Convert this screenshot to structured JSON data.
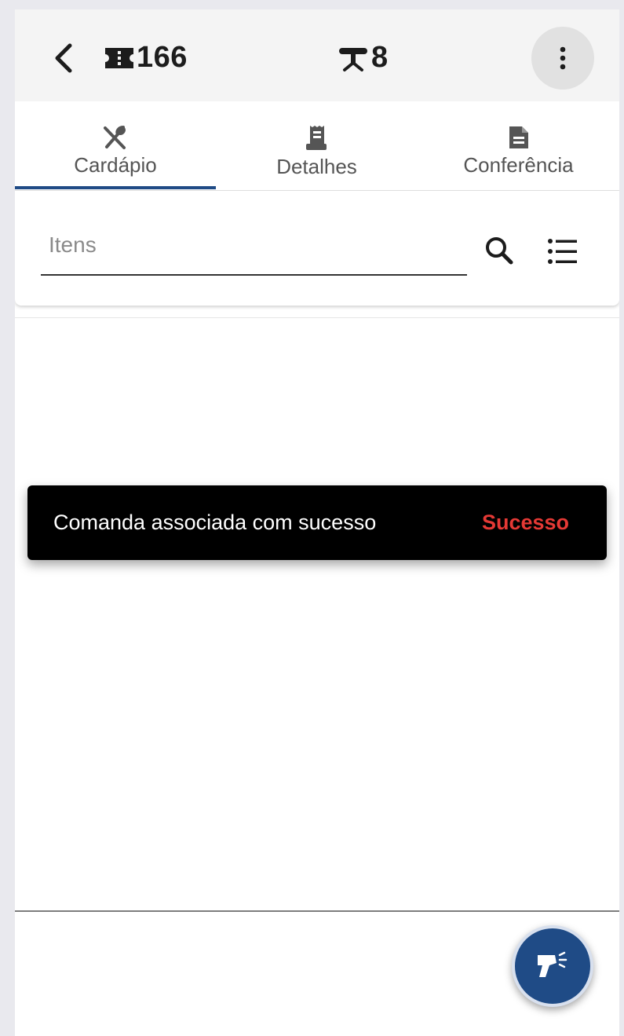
{
  "header": {
    "ticket_number": "166",
    "table_number": "8"
  },
  "tabs": [
    {
      "label": "Cardápio",
      "icon": "utensils-icon",
      "active": true
    },
    {
      "label": "Detalhes",
      "icon": "receipt-icon",
      "active": false
    },
    {
      "label": "Conferência",
      "icon": "document-icon",
      "active": false
    }
  ],
  "search": {
    "placeholder": "Itens",
    "value": ""
  },
  "snackbar": {
    "message": "Comanda associada com sucesso",
    "action": "Sucesso"
  },
  "colors": {
    "primary": "#1f4b86",
    "header_bg": "#f4f4f4",
    "snackbar_bg": "#000000",
    "snackbar_action": "#e53935"
  },
  "icons": {
    "back": "chevron-left-icon",
    "ticket": "ticket-icon",
    "table": "table-icon",
    "menu": "more-vertical-icon",
    "search": "search-icon",
    "list": "list-icon",
    "fab": "barcode-scanner-icon"
  }
}
